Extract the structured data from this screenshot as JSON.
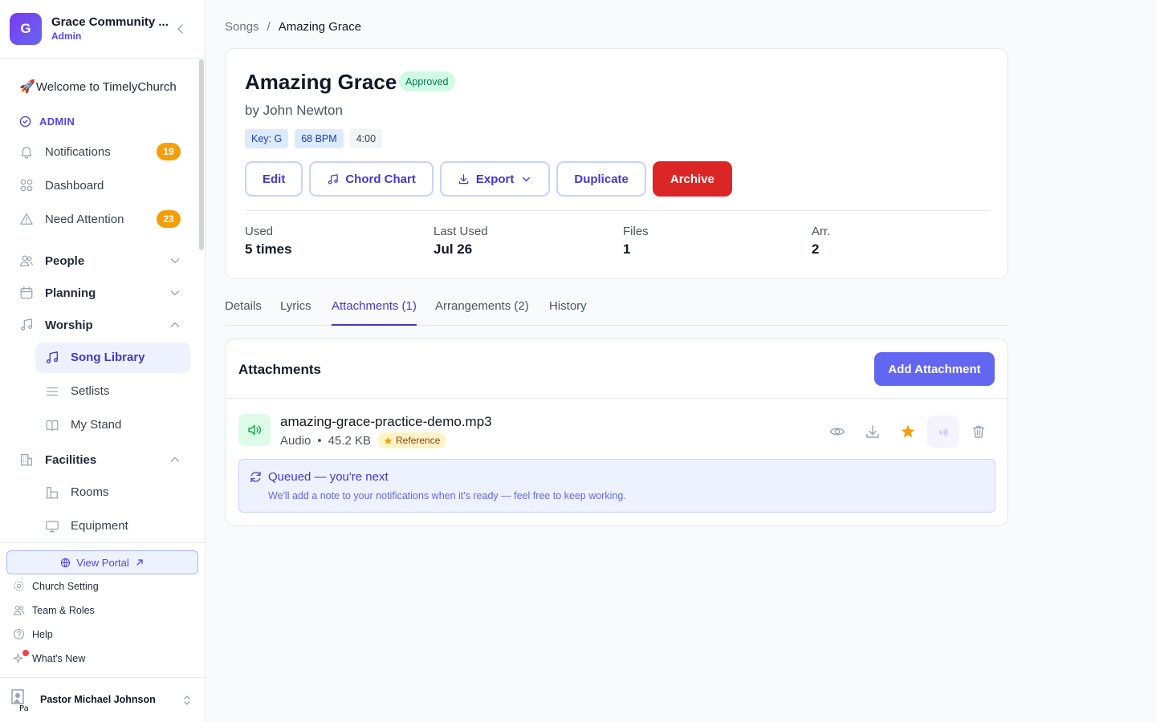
{
  "org": {
    "name": "Grace Community ...",
    "role": "Admin",
    "initial": "G"
  },
  "sidebar": {
    "welcome": "Welcome to TimelyChurch",
    "welcome_emoji": "🚀",
    "admin_label": "ADMIN",
    "items": [
      {
        "label": "Notifications",
        "badge": "19",
        "icon": "bell-icon"
      },
      {
        "label": "Dashboard",
        "icon": "grid-icon"
      },
      {
        "label": "Need Attention",
        "badge": "23",
        "icon": "alert-triangle-icon"
      },
      {
        "label": "People",
        "icon": "users-icon",
        "expanded": false
      },
      {
        "label": "Planning",
        "icon": "calendar-icon",
        "expanded": false
      },
      {
        "label": "Worship",
        "icon": "music-icon",
        "expanded": true
      },
      {
        "label": "Song Library",
        "icon": "music-note-icon",
        "active": true
      },
      {
        "label": "Setlists",
        "icon": "list-icon"
      },
      {
        "label": "My Stand",
        "icon": "book-icon"
      },
      {
        "label": "Facilities",
        "icon": "building-icon",
        "expanded": true
      },
      {
        "label": "Rooms",
        "icon": "room-icon"
      },
      {
        "label": "Equipment",
        "icon": "monitor-icon"
      }
    ],
    "portal_label": "View Portal",
    "footer_links": [
      "Church Setting",
      "Team & Roles",
      "Help",
      "What's New"
    ],
    "user_name": "Pastor Michael Johnson"
  },
  "breadcrumb": {
    "parent": "Songs",
    "separator": "/",
    "current": "Amazing Grace"
  },
  "song": {
    "title": "Amazing Grace",
    "status": "Approved",
    "author": "by John Newton",
    "tags": [
      "Key: G",
      "68 BPM",
      "4:00"
    ],
    "actions": {
      "edit": "Edit",
      "chord_chart": "Chord Chart",
      "export": "Export",
      "duplicate": "Duplicate",
      "archive": "Archive"
    },
    "stats": [
      {
        "label": "Used",
        "value": "5 times"
      },
      {
        "label": "Last Used",
        "value": "Jul 26"
      },
      {
        "label": "Files",
        "value": "1"
      },
      {
        "label": "Arr.",
        "value": "2"
      }
    ]
  },
  "tabs": [
    {
      "label": "Details"
    },
    {
      "label": "Lyrics"
    },
    {
      "label": "Attachments (1)",
      "active": true
    },
    {
      "label": "Arrangements (2)"
    },
    {
      "label": "History"
    }
  ],
  "attachments": {
    "title": "Attachments",
    "add_label": "Add Attachment",
    "file": {
      "name": "amazing-grace-practice-demo.mp3",
      "type": "Audio",
      "size": "45.2 KB",
      "badge": "Reference"
    },
    "queue": {
      "title": "Queued — you're next",
      "subtitle": "We'll add a note to your notifications when it's ready — feel free to keep working."
    }
  },
  "colors": {
    "accent": "#4f46e5",
    "primary_button": "#6366f1",
    "danger": "#dc2626",
    "badge": "#f59e0b",
    "approved": "#047857"
  }
}
